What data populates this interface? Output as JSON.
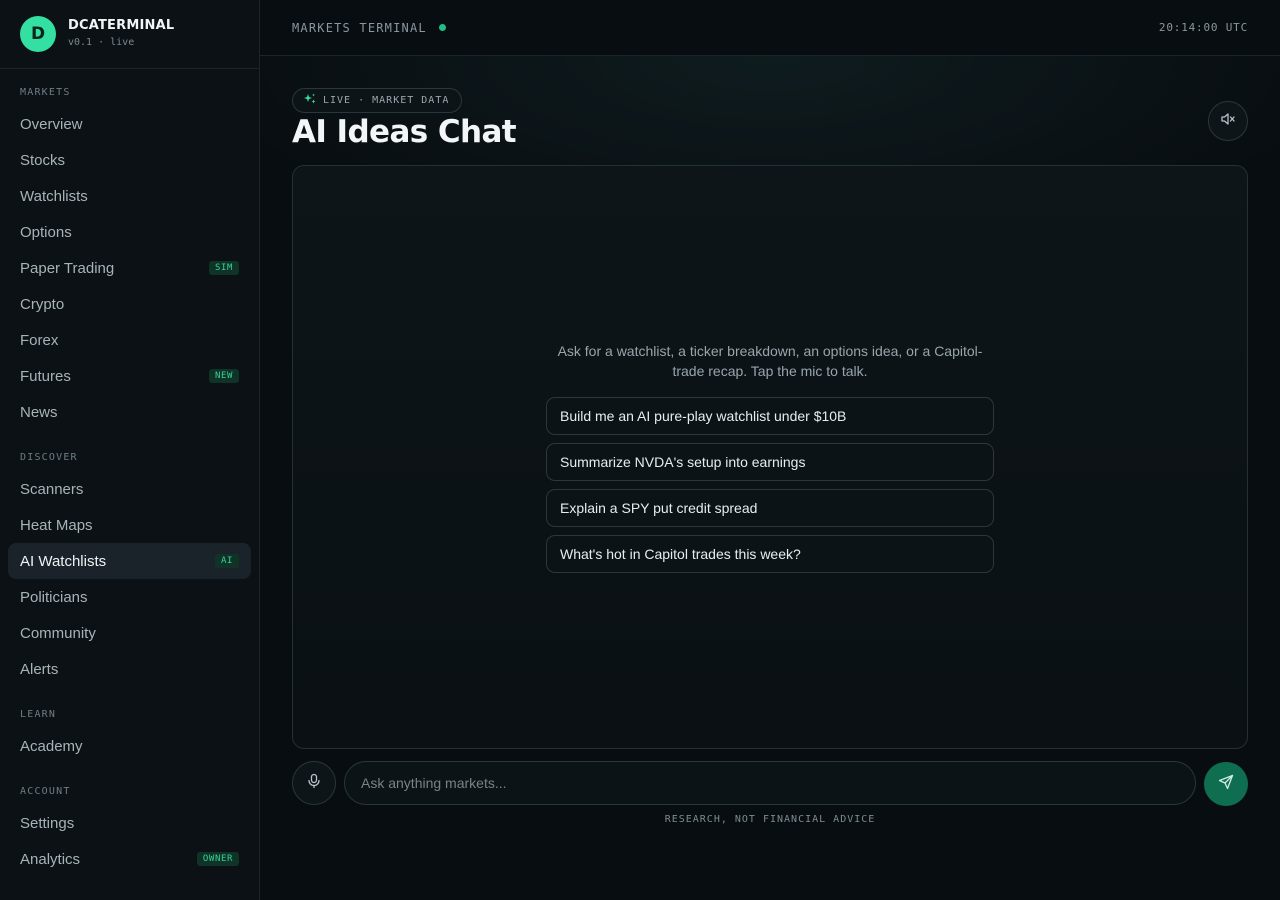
{
  "brand": {
    "logo_letter": "D",
    "name": "DCATERMINAL",
    "version": "v0.1 · live"
  },
  "sidebar": {
    "sections": [
      {
        "title": "MARKETS",
        "items": [
          {
            "label": "Overview"
          },
          {
            "label": "Stocks"
          },
          {
            "label": "Watchlists"
          },
          {
            "label": "Options"
          },
          {
            "label": "Paper Trading",
            "badge": "SIM"
          },
          {
            "label": "Crypto"
          },
          {
            "label": "Forex"
          },
          {
            "label": "Futures",
            "badge": "NEW"
          },
          {
            "label": "News"
          }
        ]
      },
      {
        "title": "DISCOVER",
        "items": [
          {
            "label": "Scanners"
          },
          {
            "label": "Heat Maps"
          },
          {
            "label": "AI Watchlists",
            "badge": "AI",
            "active": true
          },
          {
            "label": "Politicians"
          },
          {
            "label": "Community"
          },
          {
            "label": "Alerts"
          }
        ]
      },
      {
        "title": "LEARN",
        "items": [
          {
            "label": "Academy"
          }
        ]
      },
      {
        "title": "ACCOUNT",
        "items": [
          {
            "label": "Settings"
          },
          {
            "label": "Analytics",
            "badge": "OWNER"
          }
        ]
      }
    ]
  },
  "topbar": {
    "title": "MARKETS TERMINAL",
    "time": "20:14:00 UTC"
  },
  "header": {
    "pill": "LIVE · MARKET DATA",
    "title": "AI Ideas Chat"
  },
  "chat": {
    "intro": "Ask for a watchlist, a ticker breakdown, an options idea, or a Capitol-trade recap. Tap the mic to talk.",
    "suggestions": [
      "Build me an AI pure-play watchlist under $10B",
      "Summarize NVDA's setup into earnings",
      "Explain a SPY put credit spread",
      "What's hot in Capitol trades this week?"
    ],
    "input_placeholder": "Ask anything markets...",
    "disclaimer": "RESEARCH, NOT FINANCIAL ADVICE"
  },
  "colors": {
    "accent": "#34e0a1",
    "send": "#0f6e50",
    "background": "#080d11"
  }
}
